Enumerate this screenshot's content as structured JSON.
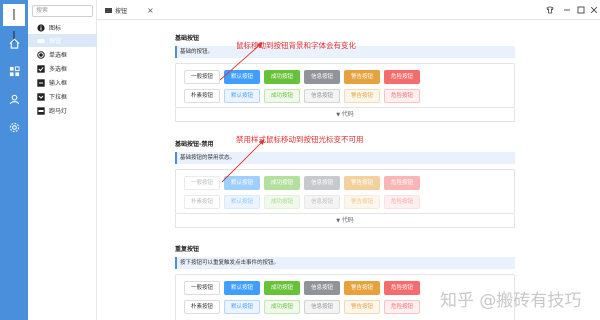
{
  "app": {
    "logo_text": "丨丨",
    "tab_label": "按钮",
    "tab_close": "×"
  },
  "search": {
    "placeholder": "搜索"
  },
  "menu": [
    {
      "label": "图标",
      "icon": "info-icon"
    },
    {
      "label": "按钮",
      "icon": "button-icon",
      "active": true
    },
    {
      "label": "单选框",
      "icon": "radio-icon"
    },
    {
      "label": "多选框",
      "icon": "checkbox-icon"
    },
    {
      "label": "输入框",
      "icon": "input-icon"
    },
    {
      "label": "下拉框",
      "icon": "select-icon"
    },
    {
      "label": "跑马灯",
      "icon": "marquee-icon"
    }
  ],
  "sections": [
    {
      "title": "基础按钮",
      "desc": "基础的按钮。",
      "row1": [
        "一般按钮",
        "默认按钮",
        "成功按钮",
        "信息按钮",
        "警告按钮",
        "危险按钮"
      ],
      "row2": [
        "朴素按钮",
        "默认按钮",
        "成功按钮",
        "信息按钮",
        "警告按钮",
        "危险按钮"
      ],
      "code": "代码"
    },
    {
      "title": "基础按钮-禁用",
      "desc": "基础按钮的禁用状态。",
      "row1": [
        "一般按钮",
        "默认按钮",
        "成功按钮",
        "信息按钮",
        "警告按钮",
        "危险按钮"
      ],
      "row2": [
        "朴素按钮",
        "默认按钮",
        "成功按钮",
        "信息按钮",
        "警告按钮",
        "危险按钮"
      ],
      "code": "代码"
    },
    {
      "title": "重复按钮",
      "desc": "按下按钮可以重复触发点击事件的按钮。",
      "row1": [
        "一般按钮",
        "默认按钮",
        "成功按钮",
        "信息按钮",
        "警告按钮",
        "危险按钮"
      ],
      "row2": [
        "朴素按钮",
        "默认按钮",
        "成功按钮",
        "信息按钮",
        "警告按钮",
        "危险按钮"
      ]
    }
  ],
  "annotations": {
    "a1": "鼠标移动到按钮背景和字体会有变化",
    "a2": "禁用样式鼠标移动到按钮光标变不可用"
  },
  "watermark": "知乎 @搬砖有技巧",
  "colors": {
    "accent": "#4a8fdb",
    "primary": "#409eff",
    "success": "#67c23a",
    "info": "#909399",
    "warning": "#e6a23c",
    "danger": "#f56c6c",
    "annotation": "#e03030"
  }
}
